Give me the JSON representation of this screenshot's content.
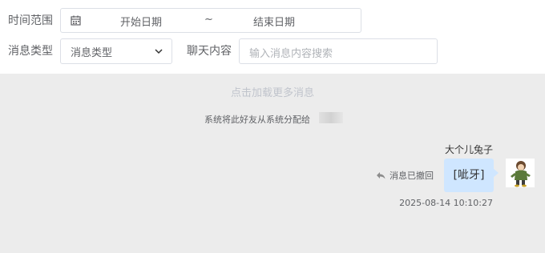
{
  "filters": {
    "time_range_label": "时间范围",
    "start_placeholder": "开始日期",
    "separator": "~",
    "end_placeholder": "结束日期",
    "message_type_label": "消息类型",
    "message_type_value": "消息类型",
    "chat_content_label": "聊天内容",
    "search_placeholder": "输入消息内容搜索",
    "icons": {
      "calendar": "calendar-icon",
      "chevron": "chevron-down-icon"
    }
  },
  "chat": {
    "load_more": "点击加载更多消息",
    "system_notice": "系统将此好友从系统分配给",
    "message": {
      "nickname": "大个儿兔子",
      "text": "[呲牙]",
      "recall_label": "消息已撤回",
      "recall_icon": "undo-icon",
      "timestamp": "2025-08-14 10:10:27"
    }
  },
  "colors": {
    "chat_background": "#ececec",
    "bubble": "#cfe6ff",
    "border": "#dcdfe6"
  }
}
